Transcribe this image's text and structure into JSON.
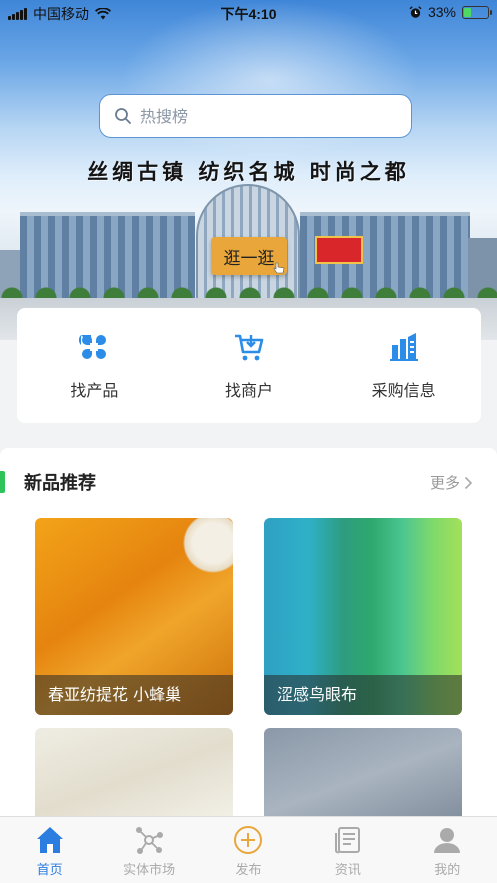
{
  "status_bar": {
    "carrier": "中国移动",
    "time": "下午4:10",
    "battery_percent": "33%",
    "battery_level": 0.33
  },
  "search": {
    "placeholder": "热搜榜"
  },
  "banner": {
    "slogan": "丝绸古镇  纺织名城  时尚之都",
    "stroll_label": "逛一逛"
  },
  "quick_actions": [
    {
      "label": "找产品",
      "icon": "product-grid-icon"
    },
    {
      "label": "找商户",
      "icon": "cart-icon"
    },
    {
      "label": "采购信息",
      "icon": "building-chart-icon"
    }
  ],
  "new_products": {
    "title": "新品推荐",
    "more_label": "更多",
    "items": [
      {
        "name": "春亚纺提花 小蜂巢"
      },
      {
        "name": "涩感鸟眼布"
      },
      {
        "name": ""
      },
      {
        "name": ""
      }
    ]
  },
  "tabbar": {
    "active_color": "#2b7de0",
    "tabs": [
      {
        "label": "首页",
        "icon": "home-icon",
        "active": true
      },
      {
        "label": "实体市场",
        "icon": "market-network-icon",
        "active": false
      },
      {
        "label": "发布",
        "icon": "plus-circle-icon",
        "active": false
      },
      {
        "label": "资讯",
        "icon": "news-icon",
        "active": false
      },
      {
        "label": "我的",
        "icon": "user-icon",
        "active": false
      }
    ]
  }
}
